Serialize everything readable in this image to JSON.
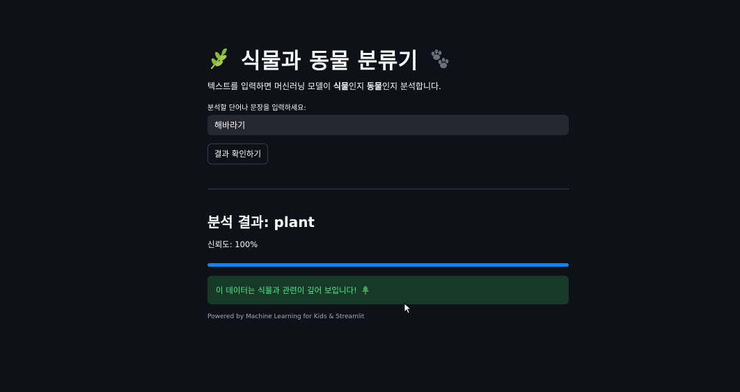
{
  "header": {
    "title": "식물과 동물 분류기",
    "title_icon": "herb-icon",
    "title_trailing_icon": "paw-prints-icon"
  },
  "description": {
    "prefix": "텍스트를 입력하면 머신러닝 모델이 ",
    "plant_word": "식물",
    "middle": "인지 ",
    "animal_word": "동물",
    "suffix": "인지 분석합니다."
  },
  "input": {
    "label": "분석할 단어나 문장을 입력하세요:",
    "value": "해바라기",
    "placeholder": ""
  },
  "button": {
    "label": "결과 확인하기"
  },
  "result": {
    "heading": "분석 결과: plant",
    "confidence_text": "신뢰도: 100%",
    "progress_percent": 100,
    "progress_color": "#1c83e1",
    "alert_text": "이 데이터는 식물과 관련이 깊어 보입니다!",
    "alert_icon": "evergreen-tree-icon",
    "alert_color": "#4fe88a"
  },
  "footer": {
    "text": "Powered by Machine Learning for Kids & Streamlit"
  },
  "colors": {
    "background": "#0e1117",
    "input_background": "#262730",
    "success_background": "#173928"
  }
}
